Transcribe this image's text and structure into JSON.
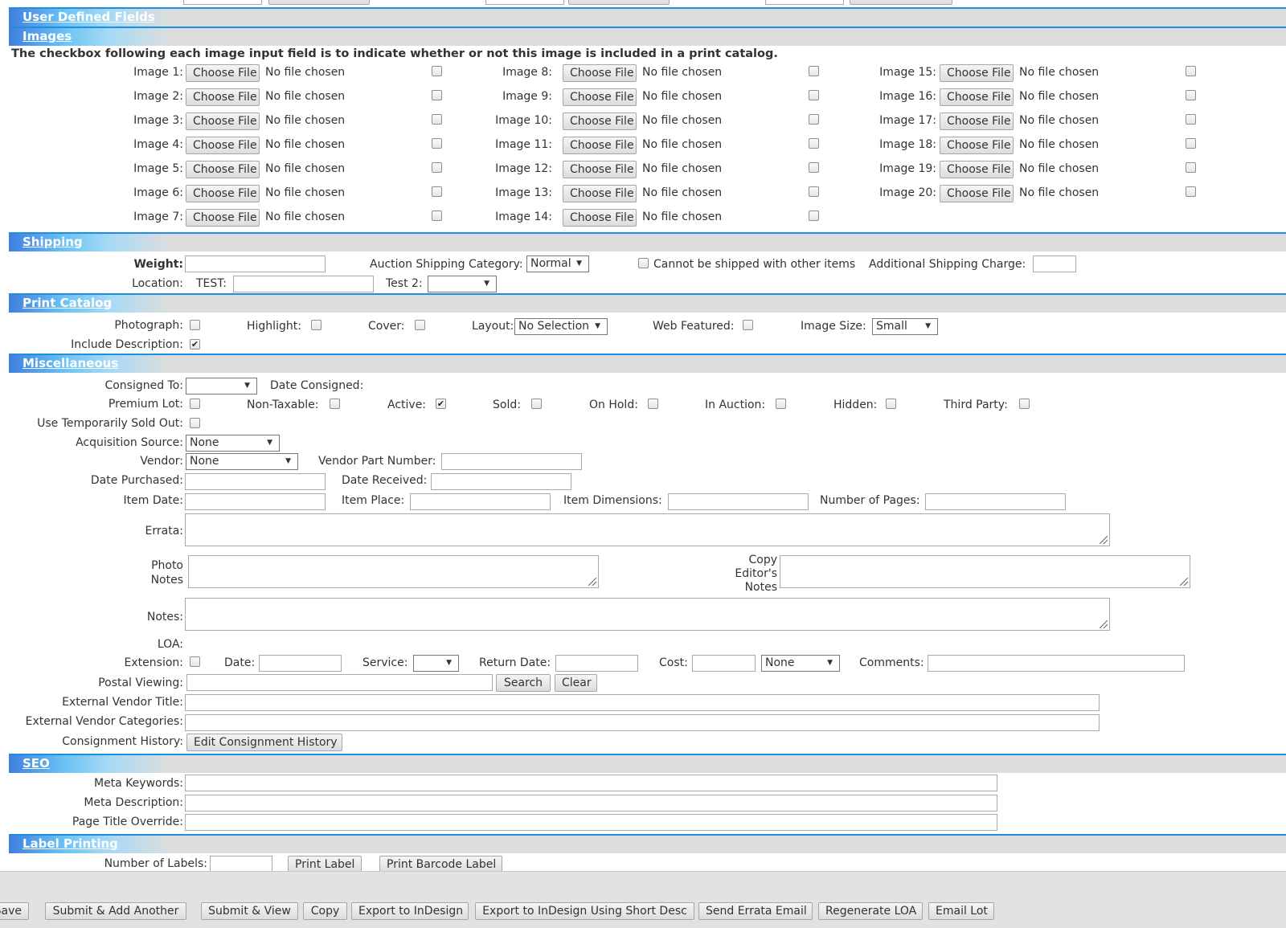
{
  "top_row": {
    "labels": [
      "",
      "",
      ""
    ]
  },
  "sections": {
    "user_defined": "User Defined Fields",
    "images": "Images",
    "shipping": "Shipping",
    "print_catalog": "Print Catalog",
    "misc": "Miscellaneous",
    "seo": "SEO",
    "label_printing": "Label Printing"
  },
  "images": {
    "note": "The checkbox following each image input field is to indicate whether or not this image is included in a print catalog.",
    "choose_label": "Choose File",
    "no_file": "No file chosen",
    "labels": [
      "Image 1:",
      "Image 2:",
      "Image 3:",
      "Image 4:",
      "Image 5:",
      "Image 6:",
      "Image 7:",
      "Image 8:",
      "Image 9:",
      "Image 10:",
      "Image 11:",
      "Image 12:",
      "Image 13:",
      "Image 14:",
      "Image 15:",
      "Image 16:",
      "Image 17:",
      "Image 18:",
      "Image 19:",
      "Image 20:"
    ]
  },
  "shipping": {
    "weight": "Weight:",
    "auction_category": "Auction Shipping Category:",
    "auction_category_value": "Normal",
    "cannot_ship": "Cannot be shipped with other items",
    "additional_charge": "Additional Shipping Charge:",
    "location": "Location:",
    "test": "TEST:",
    "test2": "Test 2:"
  },
  "print_catalog": {
    "photograph": "Photograph:",
    "highlight": "Highlight:",
    "cover": "Cover:",
    "layout": "Layout:",
    "layout_value": "No Selection",
    "web_featured": "Web Featured:",
    "image_size": "Image Size:",
    "image_size_value": "Small",
    "include_description": "Include Description:",
    "include_description_checked": true
  },
  "misc": {
    "consigned_to": "Consigned To:",
    "date_consigned": "Date Consigned:",
    "premium_lot": "Premium Lot:",
    "non_taxable": "Non-Taxable:",
    "active": "Active:",
    "active_checked": true,
    "sold": "Sold:",
    "on_hold": "On Hold:",
    "in_auction": "In Auction:",
    "hidden": "Hidden:",
    "third_party": "Third Party:",
    "use_temp_sold": "Use Temporarily Sold Out:",
    "acquisition_source": "Acquisition Source:",
    "acquisition_source_value": "None",
    "vendor": "Vendor:",
    "vendor_value": "None",
    "vendor_part": "Vendor Part Number:",
    "date_purchased": "Date Purchased:",
    "date_received": "Date Received:",
    "item_date": "Item Date:",
    "item_place": "Item Place:",
    "item_dimensions": "Item Dimensions:",
    "number_of_pages": "Number of Pages:",
    "errata": "Errata:",
    "photo_notes_1": "Photo",
    "photo_notes_2": "Notes",
    "copy_editor_1": "Copy",
    "copy_editor_2": "Editor's",
    "copy_editor_3": "Notes",
    "notes": "Notes:",
    "loa": "LOA:",
    "extension": "Extension:",
    "date": "Date:",
    "service": "Service:",
    "return_date": "Return Date:",
    "cost": "Cost:",
    "cost_select_value": "None",
    "comments": "Comments:",
    "postal_viewing": "Postal Viewing:",
    "search_btn": "Search",
    "clear_btn": "Clear",
    "ext_vendor_title": "External Vendor Title:",
    "ext_vendor_categories": "External Vendor Categories:",
    "consignment_history": "Consignment History:",
    "edit_consignment_btn": "Edit Consignment History"
  },
  "seo": {
    "meta_keywords": "Meta Keywords:",
    "meta_description": "Meta Description:",
    "page_title_override": "Page Title Override:"
  },
  "label_printing": {
    "number_of_labels": "Number of Labels:",
    "print_label": "Print Label",
    "print_barcode": "Print Barcode Label"
  },
  "bottom_buttons": [
    "Save",
    "Submit & Add Another",
    "Submit & View",
    "Copy",
    "Export to InDesign",
    "Export to InDesign Using Short Desc",
    "Send Errata Email",
    "Regenerate LOA",
    "Email Lot"
  ]
}
